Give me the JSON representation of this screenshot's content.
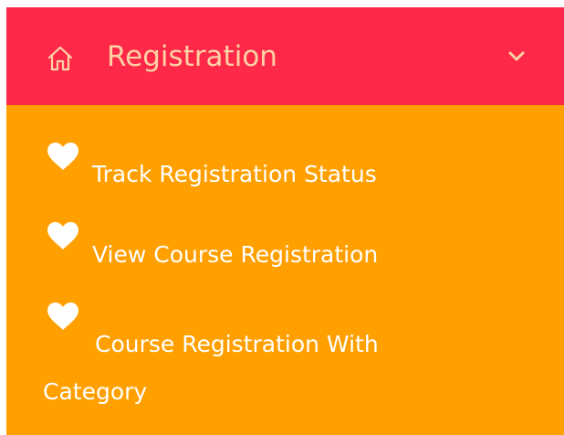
{
  "colors": {
    "header_bg": "#fe2848",
    "header_text": "#ffd2a6",
    "submenu_bg": "#ffa000",
    "submenu_text": "#ffffff"
  },
  "header": {
    "icon": "home-icon",
    "label": "Registration",
    "toggle_icon": "chevron-down-icon"
  },
  "submenu": {
    "items": [
      {
        "icon": "heart-icon",
        "label": "Track Registration Status"
      },
      {
        "icon": "heart-icon",
        "label": "View Course Registration"
      },
      {
        "icon": "heart-icon",
        "label": "Course Registration With Category"
      }
    ]
  }
}
